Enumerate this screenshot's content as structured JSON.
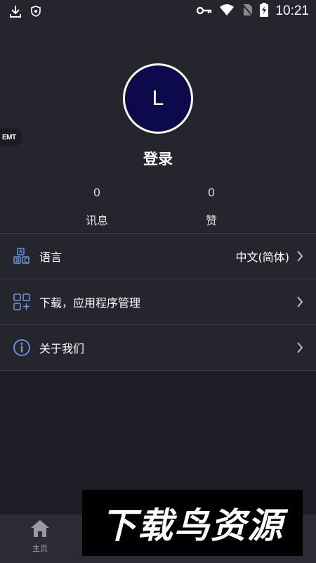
{
  "status_bar": {
    "time": "10:21",
    "icons": [
      "download-icon",
      "shield-icon",
      "key-icon",
      "wifi-icon",
      "no-sim-icon",
      "battery-charging-icon"
    ]
  },
  "profile": {
    "badge": "EMT",
    "avatar_letter": "L",
    "login_label": "登录",
    "stats": [
      {
        "value": "0",
        "label": "讯息"
      },
      {
        "value": "0",
        "label": "赞"
      }
    ]
  },
  "menu": {
    "items": [
      {
        "label": "语言",
        "value": "中文(简体)",
        "icon": "language-icon"
      },
      {
        "label": "下载，应用程序管理",
        "value": "",
        "icon": "apps-grid-icon"
      },
      {
        "label": "关于我们",
        "value": "",
        "icon": "info-icon"
      }
    ]
  },
  "bottom_nav": {
    "home_label": "主页"
  },
  "watermark": {
    "text": "下载鸟资源"
  },
  "colors": {
    "background": "#1d1d25",
    "card": "#25252e",
    "avatar": "#0c0a4a",
    "icon_accent": "#6b9be0"
  }
}
